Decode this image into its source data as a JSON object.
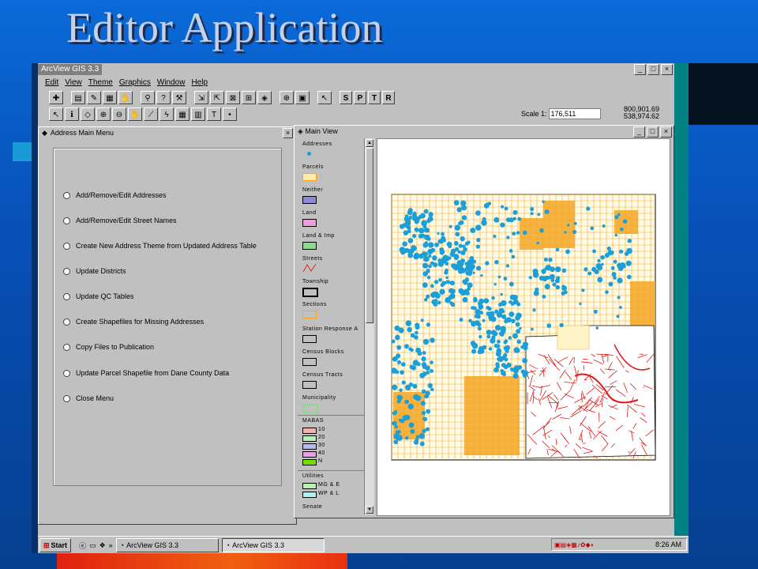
{
  "slide": {
    "title": "Editor Application"
  },
  "app": {
    "window_title": "ArcView GIS 3.3",
    "menus": [
      "Edit",
      "View",
      "Theme",
      "Graphics",
      "Window",
      "Help"
    ],
    "tool_letters": [
      "S",
      "P",
      "T",
      "R"
    ],
    "scale_label": "Scale 1:",
    "scale_value": "176,511",
    "coord_x": "800,901.69",
    "coord_y": "538,974.62"
  },
  "dialog": {
    "title": "Address Main Menu",
    "options": [
      "Add/Remove/Edit Addresses",
      "Add/Remove/Edit Street Names",
      "Create New Address Theme from Updated Address Table",
      "Update Districts",
      "Update QC Tables",
      "Create Shapefiles for Missing Addresses",
      "Copy Files to Publication",
      "Update Parcel Shapefile from Dane County Data",
      "Close Menu"
    ]
  },
  "view": {
    "title": "Main View",
    "legend": [
      {
        "label": "Addresses",
        "color": "#1a9fd8",
        "kind": "point"
      },
      {
        "label": "Parcels",
        "color": "#fde9a8",
        "kind": "box"
      },
      {
        "label": "Neither",
        "color": "#8a8ad8",
        "kind": "box"
      },
      {
        "label": "Land",
        "color": "#e8a0d8",
        "kind": "box"
      },
      {
        "label": "Land & Imp",
        "color": "#8fd890",
        "kind": "box"
      },
      {
        "label": "Streets",
        "color": "#e02020",
        "kind": "line"
      },
      {
        "label": "Township",
        "color": "#c0c0c0",
        "kind": "box-bold"
      },
      {
        "label": "Sections",
        "color": "#f5a623",
        "kind": "outline"
      },
      {
        "label": "Station Response A",
        "color": "#c0c0c0",
        "kind": "box"
      },
      {
        "label": "Census Blocks",
        "color": "#c0c0c0",
        "kind": "box"
      },
      {
        "label": "Census Tracts",
        "color": "#c0c0c0",
        "kind": "box"
      },
      {
        "label": "Municipality",
        "color": "#b8f0b8",
        "kind": "outline-green"
      }
    ],
    "mabas": {
      "title": "MABAS",
      "items": [
        {
          "label": "10",
          "color": "#f4b0b0"
        },
        {
          "label": "20",
          "color": "#b8f0b8"
        },
        {
          "label": "30",
          "color": "#b8b8f0"
        },
        {
          "label": "40",
          "color": "#e8a0e8"
        },
        {
          "label": "N",
          "color": "#70e000"
        }
      ]
    },
    "utilities": {
      "title": "Utilities",
      "items": [
        {
          "label": "MG & E",
          "color": "#b8f0b8"
        },
        {
          "label": "WP & L",
          "color": "#b0f0f0"
        }
      ]
    },
    "last_label": "Senate"
  },
  "taskbar": {
    "start": "Start",
    "tasks": [
      "ArcView GIS 3.3",
      "ArcView GIS 3.3"
    ],
    "clock": "8:26 AM"
  },
  "colors": {
    "orange": "#f5a623",
    "blue": "#1a9fd8",
    "red": "#e01818",
    "cream": "#fff5c8"
  }
}
